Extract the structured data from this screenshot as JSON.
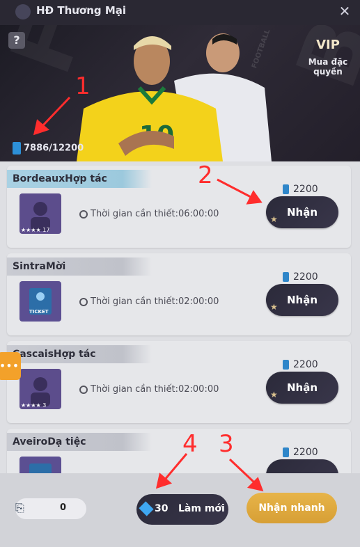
{
  "header": {
    "title": "HĐ Thương Mại",
    "close_glyph": "✕"
  },
  "banner": {
    "help_glyph": "?",
    "vip": {
      "badge": "VIP",
      "label": "Mua đặc quyền"
    },
    "energy": "7886/12200",
    "bg_text": [
      "FOOT",
      "BAL"
    ],
    "watermark": "FOOTBALL"
  },
  "annotations": {
    "a1": "1",
    "a2": "2",
    "a3": "3",
    "a4": "4"
  },
  "contracts": [
    {
      "name": "BordeauxHợp tác",
      "time": "Thời gian cần thiết:06:00:00",
      "cost": "2200",
      "claim_label": "Nhận",
      "stars": "★★★★",
      "level": "17",
      "active": true
    },
    {
      "name": "SintraMời",
      "time": "Thời gian cần thiết:02:00:00",
      "cost": "2200",
      "claim_label": "Nhận",
      "thumb_text": "TICKET"
    },
    {
      "name": "CascaisHợp tác",
      "time": "Thời gian cần thiết:02:00:00",
      "cost": "2200",
      "claim_label": "Nhận",
      "stars": "★★★★",
      "level": "3"
    },
    {
      "name": "AveiroDạ tiệc",
      "cost": "2200"
    }
  ],
  "footer": {
    "ticket_count": "0",
    "refresh_cost": "30",
    "refresh_label": "Làm mới",
    "quick_label": "Nhận nhanh"
  }
}
